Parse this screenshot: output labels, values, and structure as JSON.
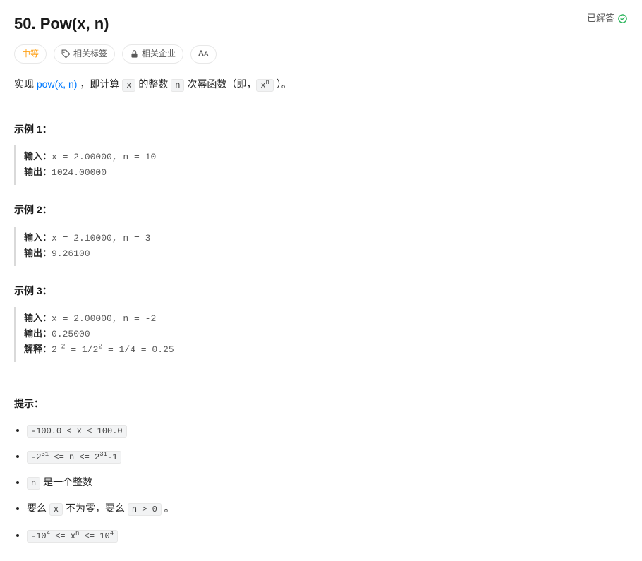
{
  "header": {
    "title": "50. Pow(x, n)",
    "solved_label": "已解答"
  },
  "tags": {
    "difficulty": "中等",
    "related_tags": "相关标签",
    "related_company": "相关企业",
    "font_size": "A"
  },
  "description": {
    "prefix": "实现 ",
    "link_text": "pow(x, n)",
    "mid1": " ，即计算 ",
    "code_x": "x",
    "mid2": " 的整数 ",
    "code_n": "n",
    "mid3": " 次幂函数（即，",
    "code_xn_base": "x",
    "code_xn_exp": "n",
    "suffix": " ）。"
  },
  "examples": [
    {
      "title": "示例 1：",
      "input_label": "输入：",
      "input_value": "x = 2.00000, n = 10",
      "output_label": "输出：",
      "output_value": "1024.00000",
      "explain_label": "",
      "explain_value": ""
    },
    {
      "title": "示例 2：",
      "input_label": "输入：",
      "input_value": "x = 2.10000, n = 3",
      "output_label": "输出：",
      "output_value": "9.26100",
      "explain_label": "",
      "explain_value": ""
    },
    {
      "title": "示例 3：",
      "input_label": "输入：",
      "input_value": "x = 2.00000, n = -2",
      "output_label": "输出：",
      "output_value": "0.25000",
      "explain_label": "解释：",
      "explain_html": "2<sup>-2</sup> = 1/2<sup>2</sup> = 1/4 = 0.25"
    }
  ],
  "hints": {
    "title": "提示：",
    "items": [
      {
        "html": "<code class='inline-code'>-100.0 &lt; x &lt; 100.0</code>"
      },
      {
        "html": "<code class='inline-code'>-2<sup>31</sup> &lt;= n &lt;= 2<sup>31</sup>-1</code>"
      },
      {
        "html": "<code class='inline-code'>n</code> 是一个整数"
      },
      {
        "html": "要么 <code class='inline-code'>x</code> 不为零，要么 <code class='inline-code'>n &gt; 0</code> 。"
      },
      {
        "html": "<code class='inline-code'>-10<sup>4</sup> &lt;= x<sup>n</sup> &lt;= 10<sup>4</sup></code>"
      }
    ]
  }
}
